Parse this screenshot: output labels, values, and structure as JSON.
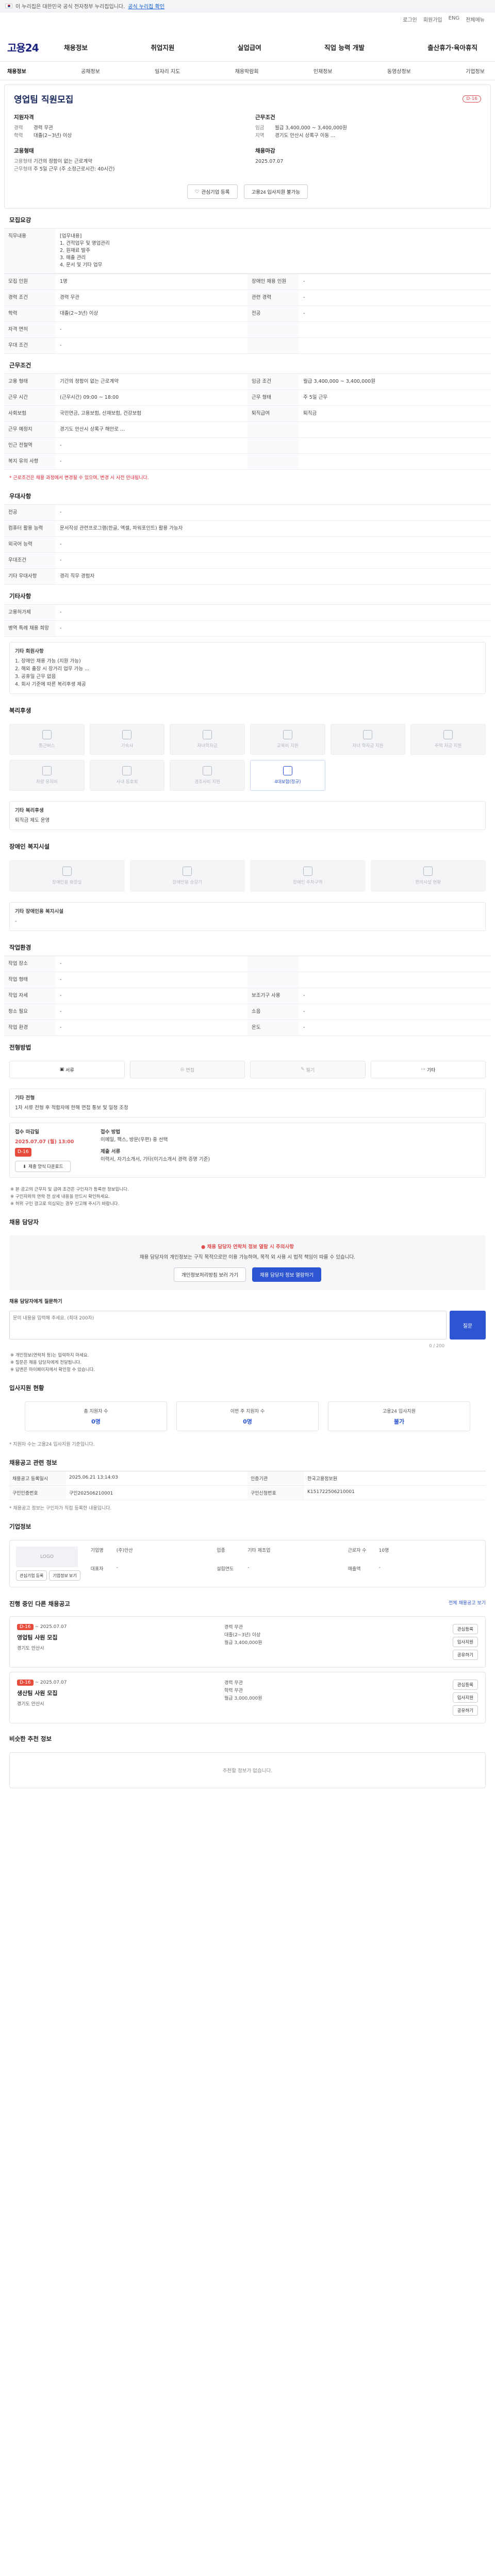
{
  "gov_banner": {
    "text": "이 누리집은 대한민국 공식 전자정부 누리집입니다.",
    "link": "공식 누리집 확인"
  },
  "util_links": [
    "로그인",
    "회원가입",
    "ENG",
    "전체메뉴"
  ],
  "site": {
    "logo": "고용24"
  },
  "main_nav": [
    "채용정보",
    "취업지원",
    "실업급여",
    "직업 능력 개발",
    "출산휴가·육아휴직"
  ],
  "sub_nav": {
    "items": [
      "채용정보",
      "공채정보",
      "일자리 지도",
      "채용박람회",
      "인재정보",
      "동영상정보",
      "기업정보"
    ],
    "active": 0
  },
  "headline": {
    "title": "영업팀 직원모집",
    "dday": "D-16",
    "requirements_title": "지원자격",
    "requirements": [
      [
        "경력",
        "경력 무관"
      ],
      [
        "학력",
        "대졸(2~3년) 이상"
      ]
    ],
    "conditions_title": "근무조건",
    "conditions": [
      [
        "임금",
        "월급 3,400,000 ~ 3,400,000원"
      ],
      [
        "지역",
        "경기도 안산시 상록구 이동 ..."
      ]
    ],
    "employment_title": "고용형태",
    "employment": [
      [
        "고용형태",
        "기간의 정함이 없는 근로계약"
      ],
      [
        "근무형태",
        "주 5일 근무 (주 소정근로시간: 40시간)"
      ]
    ],
    "deadline_title": "채용마감",
    "deadline": "2025.07.07",
    "btn_favorite": "관심기업 등록",
    "btn_apply": "고용24 입사지원 불가능"
  },
  "sec_recruit": {
    "title": "모집요강",
    "job_desc_label": "직무내용",
    "job_desc": "[업무내용]\n1. 견적업무 및 영업관리\n2. 원재료 발주\n3. 매출 관리\n4. 문서 및 기타 업무",
    "rows": [
      [
        "모집 인원",
        "1명",
        "장애인 채용 인원",
        "-"
      ],
      [
        "경력 조건",
        "경력 무관",
        "관련 경력",
        "-"
      ],
      [
        "학력",
        "대졸(2~3년) 이상",
        "전공",
        "-"
      ],
      [
        "자격 면허",
        "-",
        "",
        ""
      ],
      [
        "우대 조건",
        "-",
        "",
        ""
      ]
    ]
  },
  "sec_condition": {
    "title": "근무조건",
    "rows": [
      [
        "고용 형태",
        "기간의 정함이 없는 근로계약",
        "임금 조건",
        "월급 3,400,000 ~ 3,400,000원"
      ],
      [
        "근무 시간",
        "(근무시간) 09:00 ~ 18:00",
        "근무 형태",
        "주 5일 근무"
      ],
      [
        "사회보험",
        "국민연금, 고용보험, 산재보험, 건강보험",
        "퇴직급여",
        "퇴직금"
      ],
      [
        "근무 예정지",
        "경기도 안산시 상록구 해안로 …",
        "",
        ""
      ],
      [
        "인근 전철역",
        "-",
        "",
        ""
      ],
      [
        "복지 유의 사항",
        "-",
        "",
        ""
      ]
    ],
    "note": "* 근로조건은 채용 과정에서 변경될 수 있으며, 변경 시 사전 안내됩니다."
  },
  "sec_prefer": {
    "title": "우대사항",
    "rows": [
      [
        "전공",
        "-"
      ],
      [
        "컴퓨터 활용 능력",
        "문서작성 관련프로그램(한글, 엑셀, 파워포인트) 활용 가능자"
      ],
      [
        "외국어 능력",
        "-"
      ],
      [
        "우대조건",
        "-"
      ],
      [
        "기타 우대사항",
        "경리 직무 경험자"
      ]
    ]
  },
  "sec_etc": {
    "title": "기타사항",
    "rows": [
      [
        "고용허가제",
        "-"
      ],
      [
        "병역 특례 채용 희망",
        "-"
      ]
    ],
    "extra_label": "기타 회원사항",
    "extra": "1. 장애인 채용 가능 (지원 가능)\n2. 해외 출장 시 장거리 업무 가능 ...\n3. 공휴일 근무 없음\n4. 회사 기준에 따른 복리후생 제공"
  },
  "sec_welfare": {
    "title": "복리후생",
    "tiles": [
      "통근버스",
      "기숙사",
      "자녀학자금",
      "교육비 지원",
      "자녀 학자금 지원",
      "주택 자금 지원",
      "차량 유지비",
      "사내 동호회",
      "경조사비 지원",
      "4대보험(정규)"
    ],
    "on_index": 9,
    "extra_label": "기타 복리후생",
    "extra": "퇴직금 제도 운영"
  },
  "sec_disability": {
    "title": "장애인 복지시설",
    "tiles": [
      "장애인용 화장실",
      "장애인용 승강기",
      "장애인 주차구역",
      "편의시설 현황"
    ],
    "extra_label": "기타 장애인용 복지시설",
    "extra": "-"
  },
  "sec_environment": {
    "title": "작업환경",
    "rows": [
      [
        "작업 장소",
        "-",
        "",
        ""
      ],
      [
        "작업 형태",
        "-",
        "",
        ""
      ],
      [
        "작업 자세",
        "-",
        "보조기구 사용",
        "-"
      ],
      [
        "청소 필요",
        "-",
        "소음",
        "-"
      ],
      [
        "작업 환경",
        "-",
        "온도",
        "-"
      ]
    ]
  },
  "sec_method": {
    "title": "전형방법",
    "tiles": [
      "서류",
      "면접",
      "필기",
      "기타"
    ],
    "on_index": 0,
    "info_label": "기타 전형",
    "info": "1차 서류 전형 후 적합자에 한해 면접 통보 및 일정 조정"
  },
  "sec_apply": {
    "deadline_label": "접수 마감일",
    "deadline": "2025.07.07 (월) 13:00",
    "dday": "D-16",
    "method_label": "접수 방법",
    "method": "이메일, 팩스, 방문(우편) 중 선택",
    "doc_label": "제출 서류",
    "doc": "이력서, 자기소개서, 기타(이기소개서 경력 증명 기준)",
    "form_btn": "제출 양식 다운로드",
    "bullets": [
      "본 공고의 근무지 및 급여 조건은 구인자가 등록한 정보입니다.",
      "구인자와의 연락 전 상세 내용을 반드시 확인하세요.",
      "허위 구인 광고로 의심되는 경우 신고해 주시기 바랍니다."
    ]
  },
  "sec_manager": {
    "title": "채용 담당자",
    "notice": "채용 담당자 연락처 정보 열람 시 주의사항",
    "text": "채용 담당자의 개인정보는 구직 목적으로만 이용 가능하며, 목적 외 사용 시 법적 책임이 따를 수 있습니다.",
    "btn1": "개인정보처리방침 보러 가기",
    "btn2": "채용 담당자 정보 열람하기",
    "qa_label": "채용 담당자에게 질문하기",
    "qa_placeholder": "문의 내용을 입력해 주세요. (최대 200자)",
    "qa_counter": "0 / 200",
    "qa_send": "질문",
    "qa_bullets": [
      "개인정보(연락처 등)는 입력하지 마세요.",
      "질문은 채용 담당자에게 전달됩니다.",
      "답변은 마이페이지에서 확인할 수 있습니다."
    ]
  },
  "sec_status": {
    "title": "입사지원 현황",
    "boxes": [
      [
        "총 지원자 수",
        "0명"
      ],
      [
        "이번 주 지원자 수",
        "0명"
      ],
      [
        "고용24 입사지원",
        "불가"
      ]
    ],
    "note": "* 지원자 수는 고용24 입사지원 기준입니다."
  },
  "sec_meta": {
    "title": "채용공고 관련 정보",
    "rows": [
      [
        "채용공고 등록일시",
        "2025.06.21 13:14:03",
        "인증기관",
        "한국고용정보원"
      ],
      [
        "구인인증번호",
        "구인202506210001",
        "구인신청번호",
        "K151722506210001"
      ]
    ],
    "note": "* 채용공고 정보는 구인자가 직접 등록한 내용입니다."
  },
  "sec_company": {
    "title": "기업정보",
    "logo_text": "LOGO",
    "rows": [
      [
        "기업명",
        "(주)안산",
        "업종",
        "기타 제조업",
        "근로자 수",
        "10명"
      ],
      [
        "대표자",
        "-",
        "설립연도",
        "-",
        "매출액",
        "-"
      ]
    ],
    "btn1": "관심기업 등록",
    "btn2": "기업정보 보기"
  },
  "sec_more": {
    "title": "진행 중인 다른 채용공고",
    "link": "전체 채용공고 보기",
    "cards": [
      {
        "dday": "D-16",
        "date": "~ 2025.07.07",
        "title": "영업팀 사원 모집",
        "info1": "경력 무관",
        "info2": "대졸(2~3년) 이상",
        "wage": "월급 3,400,000원",
        "loc": "경기도 안산시"
      },
      {
        "dday": "D-16",
        "date": "~ 2025.07.07",
        "title": "생산팀 사원 모집",
        "info1": "경력 무관",
        "info2": "학력 무관",
        "wage": "월급 3,000,000원",
        "loc": "경기도 안산시"
      }
    ],
    "btns": [
      "관심등록",
      "입사지원",
      "공유하기"
    ]
  },
  "sec_similar": {
    "title": "비슷한 추천 정보",
    "empty": "추천할 정보가 없습니다."
  }
}
